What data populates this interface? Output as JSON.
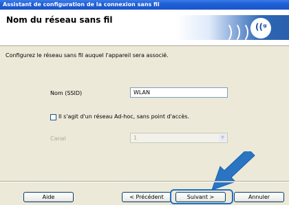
{
  "window": {
    "title": "Assistant de configuration de la connexion sans fil"
  },
  "header": {
    "title": "Nom du réseau sans fil",
    "logo_glyph": "((ᵍ",
    "logo_icon": "wireless-logo-icon"
  },
  "main": {
    "description": "Configurez le réseau sans fil auquel l'appareil sera associé.",
    "ssid_label": "Nom (SSID)",
    "ssid_value": "WLAN",
    "adhoc_label": "Il s'agit d'un réseau Ad-hoc, sans point d'accès.",
    "adhoc_checked": false,
    "channel_label": "Canal",
    "channel_value": "1"
  },
  "buttons": {
    "help": "Aide",
    "previous": "< Précédent",
    "next": "Suivant >",
    "cancel": "Annuler"
  },
  "colors": {
    "accent": "#1f6fc6",
    "titlebar": "#1f5fd6"
  }
}
